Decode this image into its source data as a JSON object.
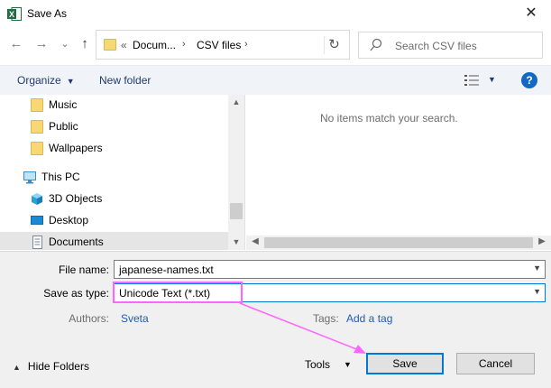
{
  "window": {
    "title": "Save As",
    "close_glyph": "✕",
    "app_icon": "excel-icon"
  },
  "nav": {
    "back_glyph": "←",
    "forward_glyph": "→",
    "recent_glyph": "⌄",
    "up_glyph": "↑"
  },
  "address": {
    "overflow": "«",
    "crumbs": [
      "Docum...",
      "CSV files"
    ],
    "separator": "›",
    "refresh_glyph": "↻"
  },
  "search": {
    "placeholder": "Search CSV files"
  },
  "commands": {
    "organize": "Organize",
    "new_folder": "New folder",
    "help": "?"
  },
  "nav_pane": {
    "items": [
      {
        "label": "Music",
        "icon": "folder-icon"
      },
      {
        "label": "Public",
        "icon": "folder-icon"
      },
      {
        "label": "Wallpapers",
        "icon": "folder-icon"
      },
      {
        "label": "This PC",
        "icon": "computer-icon"
      },
      {
        "label": "3D Objects",
        "icon": "cube-icon"
      },
      {
        "label": "Desktop",
        "icon": "desktop-icon"
      },
      {
        "label": "Documents",
        "icon": "documents-icon",
        "selected": true
      }
    ]
  },
  "content": {
    "empty_message": "No items match your search."
  },
  "form": {
    "file_name_label": "File name:",
    "file_name_value": "japanese-names.txt",
    "save_type_label": "Save as type:",
    "save_type_value": "Unicode Text (*.txt)",
    "authors_label": "Authors:",
    "authors_value": "Sveta",
    "tags_label": "Tags:",
    "tags_value": "Add a tag"
  },
  "footer": {
    "hide_folders": "Hide Folders",
    "tools": "Tools",
    "save": "Save",
    "cancel": "Cancel"
  },
  "colors": {
    "annotation": "#ff66ff",
    "accent": "#0078d7",
    "link": "#1a5fb4"
  }
}
